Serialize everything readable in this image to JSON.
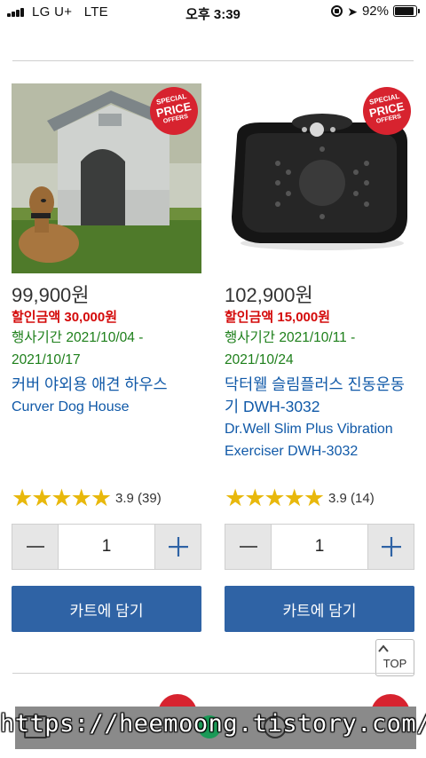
{
  "status_bar": {
    "carrier": "LG U+",
    "network": "LTE",
    "time": "오후 3:39",
    "battery_percent": "92%",
    "battery_level": 0.92
  },
  "products": [
    {
      "price": "99,900원",
      "discount": "할인금액 30,000원",
      "period": "행사기간 2021/10/04 - 2021/10/17",
      "name_ko": "커버 야외용 애견 하우스",
      "name_en": "Curver Dog House",
      "rating_text": "3.9 (39)",
      "stars_filled": 5,
      "quantity": "1",
      "cart_label": "카트에 담기",
      "badge": {
        "line1": "SPECIAL",
        "line2": "PRICE",
        "line3": "OFFERS"
      },
      "image_icon": "dog-house-photo"
    },
    {
      "price": "102,900원",
      "discount": "할인금액 15,000원",
      "period": "행사기간 2021/10/11 - 2021/10/24",
      "name_ko": "닥터웰 슬림플러스 진동운동기 DWH-3032",
      "name_en": "Dr.Well Slim Plus Vibration Exerciser DWH-3032",
      "rating_text": "3.9 (14)",
      "stars_filled": 5,
      "quantity": "1",
      "cart_label": "카트에 담기",
      "badge": {
        "line1": "SPECIAL",
        "line2": "PRICE",
        "line3": "OFFERS"
      },
      "image_icon": "vibration-plate-photo"
    }
  ],
  "top_button_label": "TOP",
  "watermark": "https://heemoong.tistory.com/",
  "colors": {
    "accent_blue": "#2f63a5",
    "link_blue": "#1059a8",
    "discount_red": "#d40a0a",
    "period_green": "#1d7f1a",
    "star_gold": "#e8b80c",
    "badge_red": "#d7232f"
  },
  "icons": [
    "signal-icon",
    "orientation-lock-icon",
    "location-arrow-icon",
    "battery-icon",
    "minus-icon",
    "plus-icon",
    "chevron-up-icon"
  ]
}
